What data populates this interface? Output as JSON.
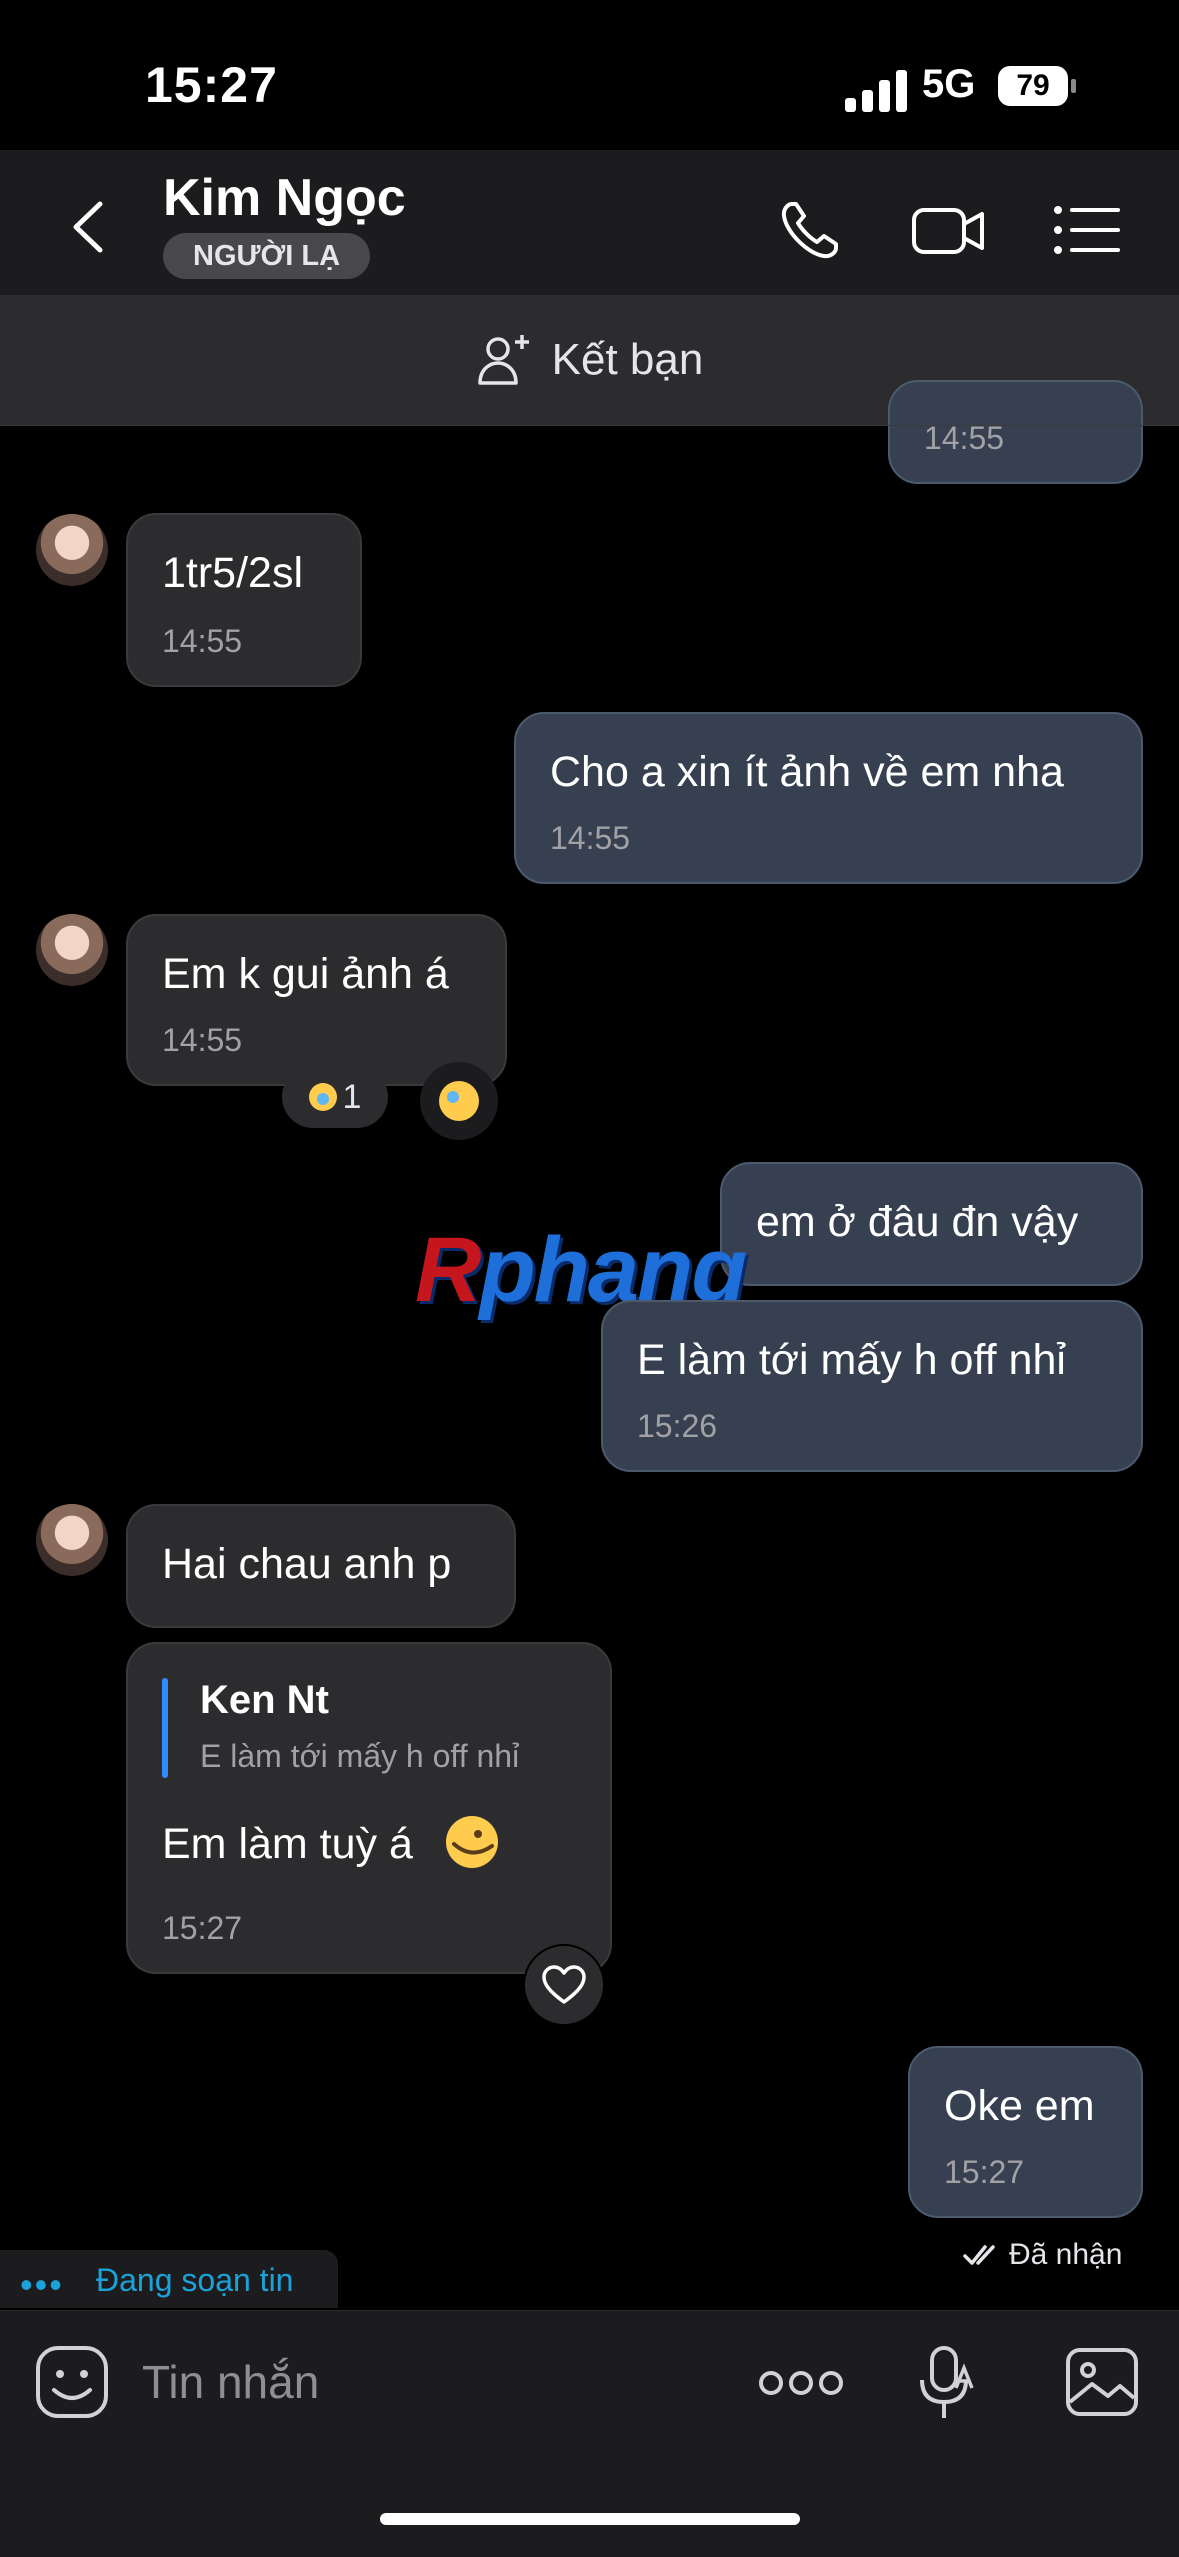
{
  "status_bar": {
    "time": "15:27",
    "network": "5G",
    "battery": "79"
  },
  "header": {
    "name": "Kim Ngọc",
    "badge": "NGƯỜI LẠ",
    "icons": [
      "back-icon",
      "phone-icon",
      "video-call-icon",
      "menu-list-icon"
    ]
  },
  "add_friend": {
    "label": "Kết bạn"
  },
  "watermark": {
    "part1": "R",
    "part2": "phang"
  },
  "messages": [
    {
      "side": "out",
      "text": "",
      "time": "14:55"
    },
    {
      "side": "in",
      "text": "1tr5/2sl",
      "time": "14:55"
    },
    {
      "side": "out",
      "text": "Cho a xin ít ảnh về em nha",
      "time": "14:55"
    },
    {
      "side": "in",
      "text": "Em k gui ảnh á",
      "time": "14:55",
      "reaction_count": "1"
    },
    {
      "side": "out",
      "text": "em ở đâu đn vậy",
      "time": ""
    },
    {
      "side": "out",
      "text": "E làm tới mấy h off nhỉ",
      "time": "15:26"
    },
    {
      "side": "in",
      "text": "Hai chau anh p",
      "time": ""
    },
    {
      "side": "in",
      "text": "Em làm tuỳ á",
      "time": "15:27",
      "quote": {
        "name": "Ken Nt",
        "text": "E làm tới mấy h off nhỉ"
      }
    },
    {
      "side": "out",
      "text": "Oke em",
      "time": "15:27"
    }
  ],
  "delivery_status": "Đã nhận",
  "typing_indicator": {
    "dots": "•••",
    "text": "Đang soạn tin"
  },
  "composer": {
    "placeholder": "Tin nhắn"
  },
  "colors": {
    "incoming_bubble": "#2c2c2e",
    "outgoing_bubble": "#364050",
    "accent": "#1aa3d9"
  }
}
